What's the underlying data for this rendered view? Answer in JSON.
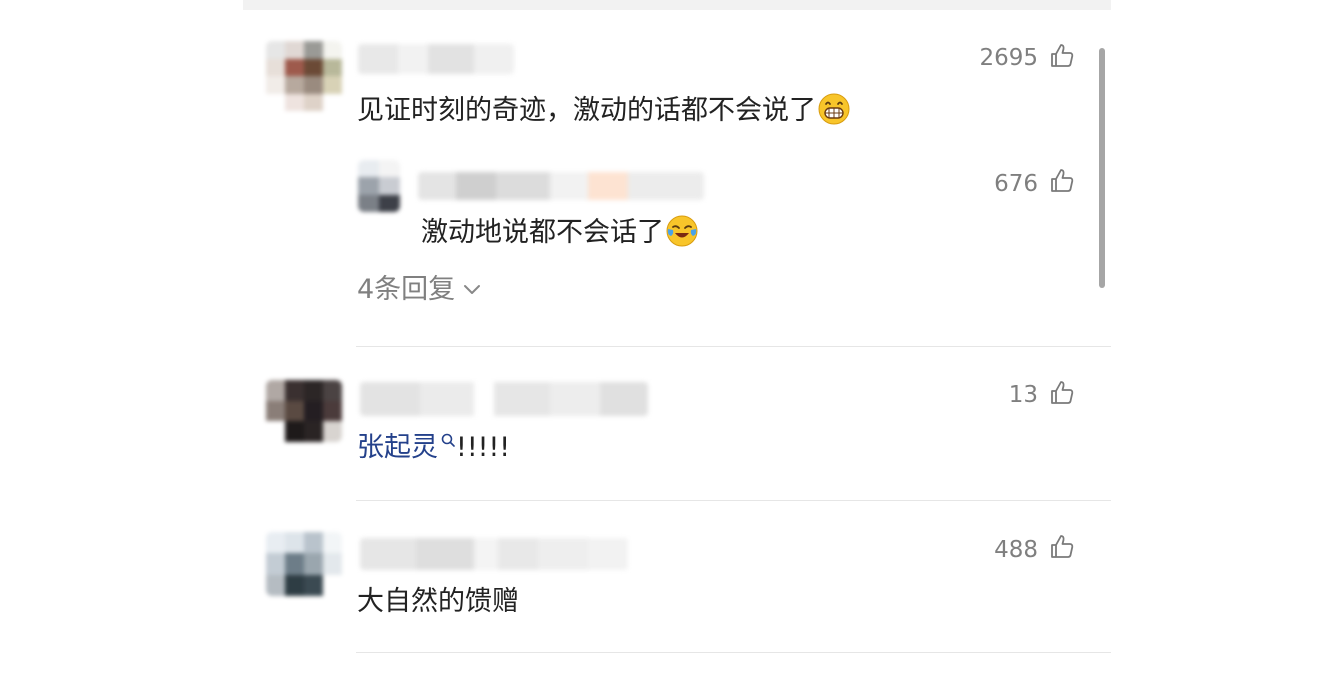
{
  "comments": [
    {
      "text": "见证时刻的奇迹，激动的话都不会说了",
      "emoji": "grinning-face-emoji",
      "likes": "2695",
      "sub_reply": {
        "text": "激动地说都不会话了",
        "emoji": "crying-laughing-emoji",
        "likes": "676"
      },
      "replies_label": "4条回复"
    },
    {
      "topic": "张起灵",
      "suffix": "!!!!!",
      "likes": "13"
    },
    {
      "text": "大自然的馈赠",
      "likes": "488"
    }
  ],
  "colors": {
    "topic_link": "#24418b",
    "count_gray": "#7f7f7f",
    "text": "#222222"
  }
}
